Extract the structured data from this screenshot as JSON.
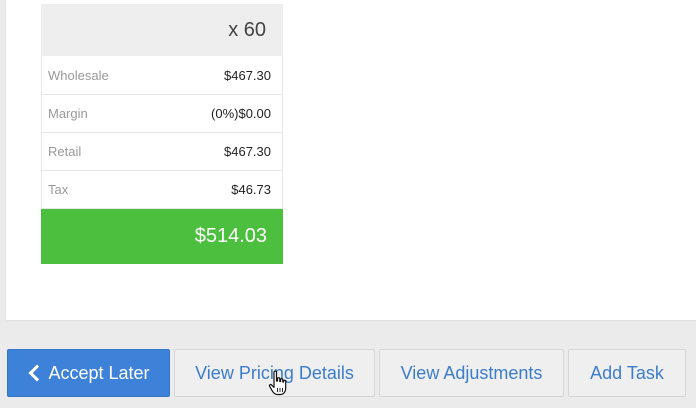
{
  "price_card": {
    "quantity": "x 60",
    "rows": [
      {
        "label": "Wholesale",
        "value": "$467.30"
      },
      {
        "label": "Margin",
        "value": "(0%)$0.00"
      },
      {
        "label": "Retail",
        "value": "$467.30"
      },
      {
        "label": "Tax",
        "value": "$46.73"
      }
    ],
    "total": "$514.03",
    "total_color": "#4dbf3f"
  },
  "actions": {
    "accept_later": "Accept Later",
    "view_pricing_details": "View Pricing Details",
    "view_adjustments": "View Adjustments",
    "add_task": "Add Task",
    "primary_color": "#3d82d8",
    "link_color": "#3c7dc9"
  },
  "icons": {
    "accept_later_icon": "chevron-left-icon",
    "cursor": "hand-pointer-icon"
  }
}
